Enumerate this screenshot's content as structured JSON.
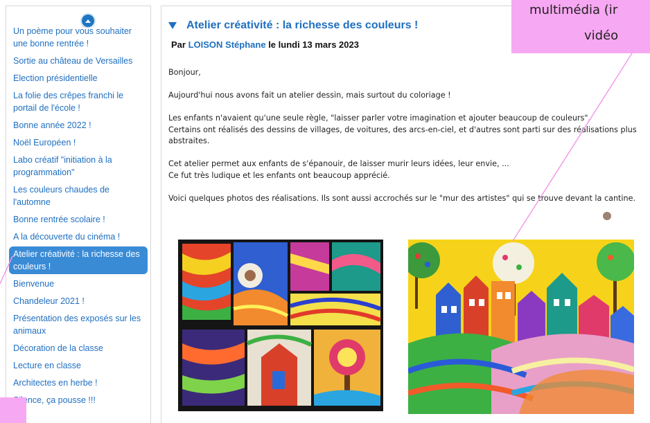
{
  "sidebar": {
    "items": [
      {
        "label": "Un poème pour vous souhaiter une bonne rentrée !",
        "active": false
      },
      {
        "label": "Sortie au château de Versailles",
        "active": false
      },
      {
        "label": "Election présidentielle",
        "active": false
      },
      {
        "label": "La folie des crêpes franchi le portail de l'école !",
        "active": false
      },
      {
        "label": "Bonne année 2022 !",
        "active": false
      },
      {
        "label": "Noël Européen !",
        "active": false
      },
      {
        "label": "Labo créatif \"initiation à la programmation\"",
        "active": false
      },
      {
        "label": "Les couleurs chaudes de l'automne",
        "active": false
      },
      {
        "label": "Bonne rentrée scolaire !",
        "active": false
      },
      {
        "label": "A la découverte du cinéma !",
        "active": false
      },
      {
        "label": "Atelier créativité : la richesse des couleurs !",
        "active": true
      },
      {
        "label": "Bienvenue",
        "active": false
      },
      {
        "label": "Chandeleur 2021 !",
        "active": false
      },
      {
        "label": "Présentation des exposés sur les animaux",
        "active": false
      },
      {
        "label": "Décoration de la classe",
        "active": false
      },
      {
        "label": "Lecture en classe",
        "active": false
      },
      {
        "label": "Architectes en herbe !",
        "active": false
      },
      {
        "label": "Silence, ça pousse !!!",
        "active": false
      }
    ]
  },
  "article": {
    "title": "Atelier créativité : la richesse des couleurs !",
    "byline_prefix": "Par",
    "author": "LOISON Stéphane",
    "byline_date": "le lundi 13 mars 2023",
    "paragraphs": [
      "Bonjour,",
      "Aujourd'hui nous avons fait un atelier dessin, mais surtout du coloriage !",
      "Les enfants n'avaient qu'une seule règle, \"laisser parler votre imagination et ajouter beaucoup de couleurs\".",
      "Certains ont réalisés des dessins de villages, de voitures, des arcs-en-ciel, et d'autres sont parti sur des réalisations plus abstraites.",
      "Cet atelier permet aux enfants de s'épanouir, de laisser murir leurs idées, leur envie, ...",
      "Ce fut très ludique et les enfants ont beaucoup apprécié.",
      "Voici quelques photos des réalisations. Ils sont aussi accrochés sur le \"mur des artistes\" qui se trouve devant la cantine."
    ]
  },
  "overlay": {
    "line1": "multimédia (ir",
    "line2": "vidéo"
  },
  "colors": {
    "link": "#1f6fc0",
    "active_bg": "#3a8bd6",
    "scroll_button": "#1f76c3",
    "pink_overlay": "#f7a8f2"
  },
  "icons": {
    "scroll_up": "chevron-up-icon",
    "collapse": "triangle-down-icon"
  }
}
